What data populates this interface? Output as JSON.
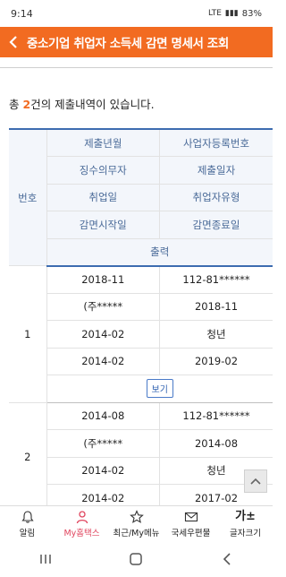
{
  "status_bar": {
    "time": "9:14",
    "network": "LTE",
    "battery": "83%"
  },
  "header": {
    "title": "중소기업 취업자 소득세 감면 명세서 조회",
    "back_icon": "chevron-left-icon"
  },
  "summary": {
    "prefix": "총 ",
    "count": "2",
    "suffix": "건의 제출내역이 있습니다."
  },
  "table": {
    "headers": {
      "num": "번호",
      "rows": [
        [
          "제출년월",
          "사업자등록번호"
        ],
        [
          "징수의무자",
          "제출일자"
        ],
        [
          "취업일",
          "취업자유형"
        ],
        [
          "감면시작일",
          "감면종료일"
        ]
      ],
      "output": "출력"
    },
    "records": [
      {
        "num": "1",
        "rows": [
          [
            "2018-11",
            "112-81******"
          ],
          [
            "(주*****",
            "2018-11"
          ],
          [
            "2014-02",
            "청년"
          ],
          [
            "2014-02",
            "2019-02"
          ]
        ],
        "view_label": "보기"
      },
      {
        "num": "2",
        "rows": [
          [
            "2014-08",
            "112-81******"
          ],
          [
            "(주*****",
            "2014-08"
          ],
          [
            "2014-02",
            "청년"
          ],
          [
            "2014-02",
            "2017-02"
          ]
        ]
      }
    ]
  },
  "bottom_nav": {
    "items": [
      {
        "label": "알림",
        "icon": "bell-icon"
      },
      {
        "label": "My홈택스",
        "icon": "person-icon",
        "active": true
      },
      {
        "label": "최근/My메뉴",
        "icon": "star-icon"
      },
      {
        "label": "국세우편물",
        "icon": "mail-icon"
      },
      {
        "label": "글자크기",
        "icon_text": "가±"
      }
    ]
  },
  "colors": {
    "accent": "#f26b21",
    "table_header_text": "#4a6a98",
    "table_border": "#3d6cb0",
    "active_nav": "#e0455e"
  }
}
